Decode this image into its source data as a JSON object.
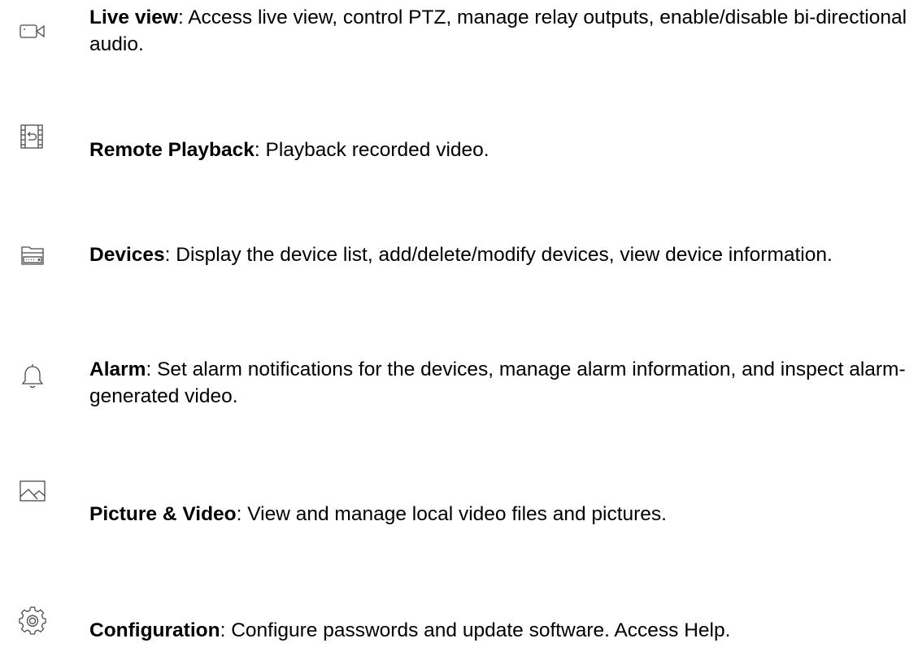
{
  "items": [
    {
      "icon": "video-camera-icon",
      "title": "Live view",
      "description": ": Access live view, control PTZ, manage relay outputs, enable/disable bi-directional audio."
    },
    {
      "icon": "playback-film-icon",
      "title": "Remote Playback",
      "description": ": Playback recorded video."
    },
    {
      "icon": "device-recorder-icon",
      "title": "Devices",
      "description": ": Display the device list, add/delete/modify devices, view device information."
    },
    {
      "icon": "bell-icon",
      "title": "Alarm",
      "description": ": Set alarm notifications for the devices, manage alarm information, and inspect alarm-generated video."
    },
    {
      "icon": "picture-icon",
      "title": "Picture & Video",
      "description": ": View and manage local video files and pictures."
    },
    {
      "icon": "gear-icon",
      "title": "Configuration",
      "description": ": Configure passwords and update software. Access Help."
    }
  ],
  "colors": {
    "text": "#000000",
    "icon_stroke": "#4a4a4a",
    "background": "#ffffff"
  }
}
